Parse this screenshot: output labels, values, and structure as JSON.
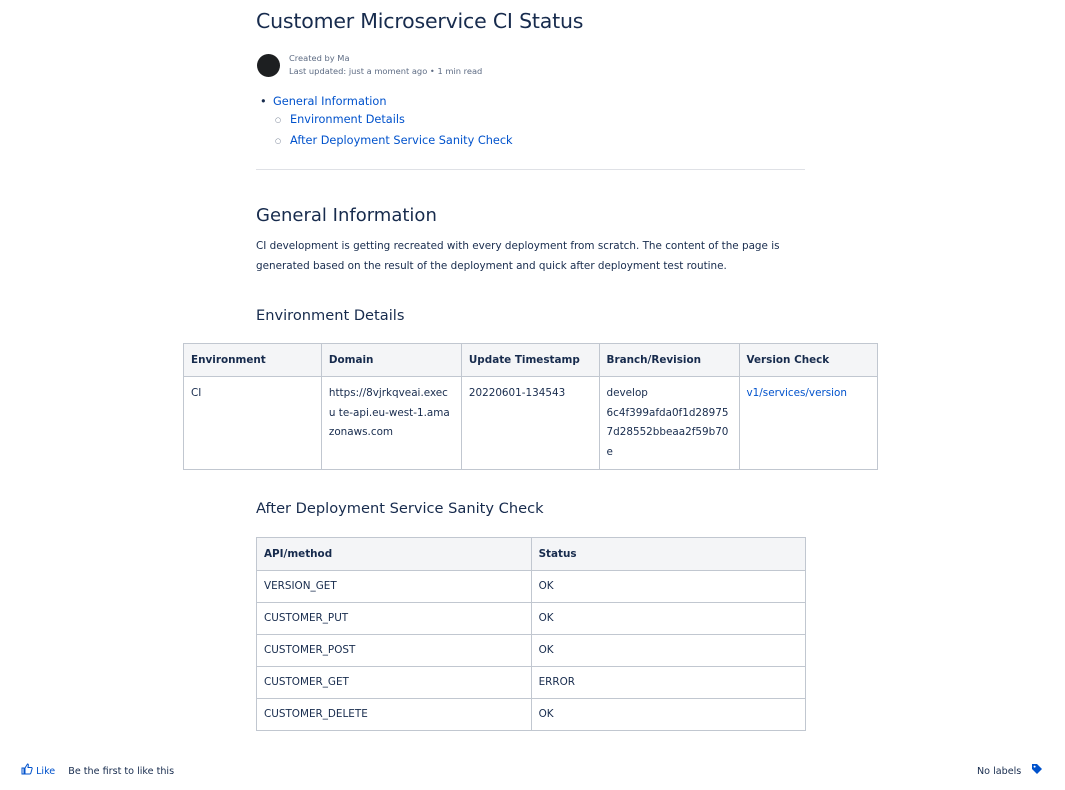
{
  "page": {
    "title": "Customer Microservice CI Status",
    "created_by": "Created by Ma",
    "last_updated": "Last updated: just a moment ago • 1 min read"
  },
  "toc": [
    {
      "label": "General Information"
    },
    {
      "label": "Environment Details"
    },
    {
      "label": "After Deployment Service Sanity Check"
    }
  ],
  "general": {
    "heading": "General Information",
    "paragraph": "CI development is getting recreated with every deployment from scratch. The content of the page is generated based on the result of the deployment and quick after deployment test routine."
  },
  "environment": {
    "heading": "Environment Details",
    "headers": [
      "Environment",
      "Domain",
      "Update Timestamp",
      "Branch/Revision",
      "Version Check"
    ],
    "row": {
      "environment": "CI",
      "domain": "https://8vjrkqveai.execu te-api.eu-west-1.amazonaws.com",
      "timestamp": "20220601-134543",
      "branch": "develop",
      "revision": "6c4f399afda0f1d289757d28552bbeaa2f59b70e",
      "version_check": "v1/services/version"
    }
  },
  "sanity": {
    "heading": "After Deployment Service Sanity Check",
    "headers": [
      "API/method",
      "Status"
    ],
    "rows": [
      {
        "api": "VERSION_GET",
        "status": "OK"
      },
      {
        "api": "CUSTOMER_PUT",
        "status": "OK"
      },
      {
        "api": "CUSTOMER_POST",
        "status": "OK"
      },
      {
        "api": "CUSTOMER_GET",
        "status": "ERROR"
      },
      {
        "api": "CUSTOMER_DELETE",
        "status": "OK"
      }
    ]
  },
  "footer": {
    "like": "Like",
    "like_text": "Be the first to like this",
    "labels": "No labels"
  },
  "icons": {
    "like": "thumbs-up-icon",
    "label": "tag-icon"
  },
  "colors": {
    "link": "#0052cc",
    "text": "#172b4d",
    "table_header_bg": "#f4f5f7"
  }
}
